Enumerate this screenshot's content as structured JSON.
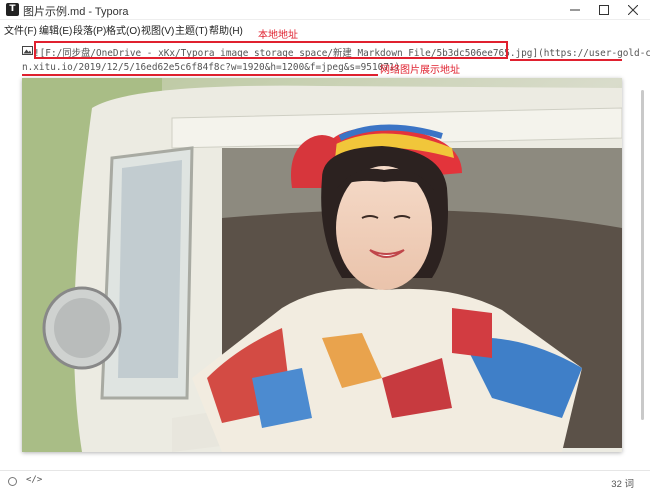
{
  "window": {
    "title": "图片示例.md - Typora",
    "app_icon": "T"
  },
  "menu": [
    "文件(F)",
    "编辑(E)",
    "段落(P)",
    "格式(O)",
    "视图(V)",
    "主题(T)",
    "帮助(H)"
  ],
  "editor": {
    "annotation_local": "本地地址",
    "annotation_web": "网络图片展示地址",
    "source_line1_prefix": "![",
    "source_line1_local": "F:/同步盘/OneDrive - xKx/Typora image storage space/新建 Markdown File/5b3dc506ee765.jpg",
    "source_line1_bracket_close": "]",
    "source_line1_url_start": "(https://user-gold-cd",
    "source_line2": "n.xitu.io/2019/12/5/16ed62e5c6f84f8c?w=1920&h=1200&f=jpeg&s=951071)",
    "image_alt_icon": "image-icon"
  },
  "status": {
    "source_toggle": "</>",
    "word_count": "32 词"
  },
  "colors": {
    "annotation_red": "#e0212f"
  }
}
